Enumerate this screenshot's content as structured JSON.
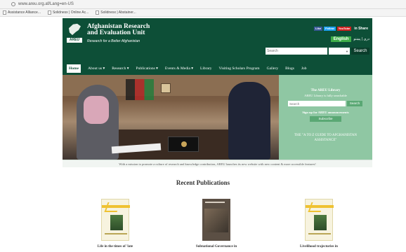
{
  "browser": {
    "url": "www.areu.org.af/Lang=en-US",
    "bookmarks": [
      "Assistance Alliance...",
      "Solidnesx | Online Ac...",
      "Solidnesx | Abstainer..."
    ]
  },
  "header": {
    "logo_label": "AREU",
    "title_line1": "Afghanistan Research",
    "title_line2": "and Evaluation Unit",
    "tagline": "Research for a Better Afghanistan",
    "social": [
      "Like",
      "Follow",
      "YouTube",
      "in Share"
    ],
    "lang_en": "English",
    "lang_other": "دری | پښتو",
    "search_placeholder": "Search",
    "search_select": "All",
    "search_button": "Search"
  },
  "nav": {
    "items": [
      "Home",
      "About us ▾",
      "Research ▾",
      "Publications ▾",
      "Events & Media ▾",
      "Library",
      "Visiting Scholars Program",
      "Gallery",
      "Blogs",
      "Job"
    ]
  },
  "library": {
    "title": "The AREU Library",
    "subtitle": "AREU Library is fully searchable",
    "search_placeholder": "Search",
    "search_button": "Search",
    "signup": "Sign up for AREU announcements",
    "subscribe": "Subscribe",
    "promo": "THE \"A TO Z GUIDE TO AFGHANISTAN ASSISTANCE\""
  },
  "mission": "With a mission to promote a culture of research and knowledge contribution, AREU launches its new website with new content & more accessible features!",
  "recent": {
    "title": "Recent Publications",
    "items": [
      {
        "caption": "Life in the times of 'late"
      },
      {
        "caption": "Subnational Governance in"
      },
      {
        "caption": "Livelihood trajectories in"
      }
    ]
  },
  "colors": {
    "brand_green": "#0d4f37",
    "library_green": "#8fc7a3",
    "english_button": "#3fae49"
  }
}
